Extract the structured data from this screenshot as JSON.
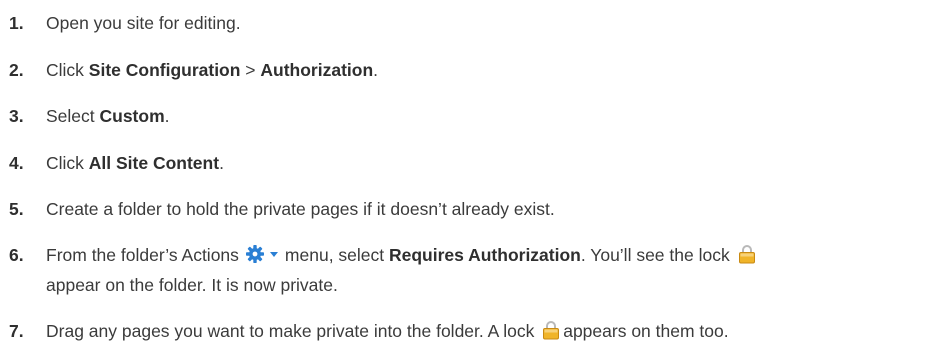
{
  "steps": [
    {
      "number": "1.",
      "text_before": "Open you site for editing."
    },
    {
      "number": "2.",
      "text_before": "Click ",
      "bold1": "Site Configuration",
      "text_mid": " > ",
      "bold2": "Authorization",
      "text_after": "."
    },
    {
      "number": "3.",
      "text_before": "Select ",
      "bold1": "Custom",
      "text_after": "."
    },
    {
      "number": "4.",
      "text_before": "Click ",
      "bold1": "All Site Content",
      "text_after": "."
    },
    {
      "number": "5.",
      "text_before": "Create a folder to hold the private pages if it doesn’t already exist."
    },
    {
      "number": "6.",
      "text_before": "From the folder’s Actions",
      "text_mid": "menu, select ",
      "bold1": "Requires Authorization",
      "text_after": ". You’ll see the lock",
      "line2": "appear on the folder. It is now private."
    },
    {
      "number": "7.",
      "text_before": "Drag any pages you want to make private into the folder. A lock",
      "text_after": "appears on them too."
    }
  ],
  "icons": {
    "actions": "gear-icon",
    "actions_menu": "chevron-down-icon",
    "lock": "lock-icon",
    "accent_blue": "#2a7fd4",
    "lock_gold": "#e8a820"
  }
}
